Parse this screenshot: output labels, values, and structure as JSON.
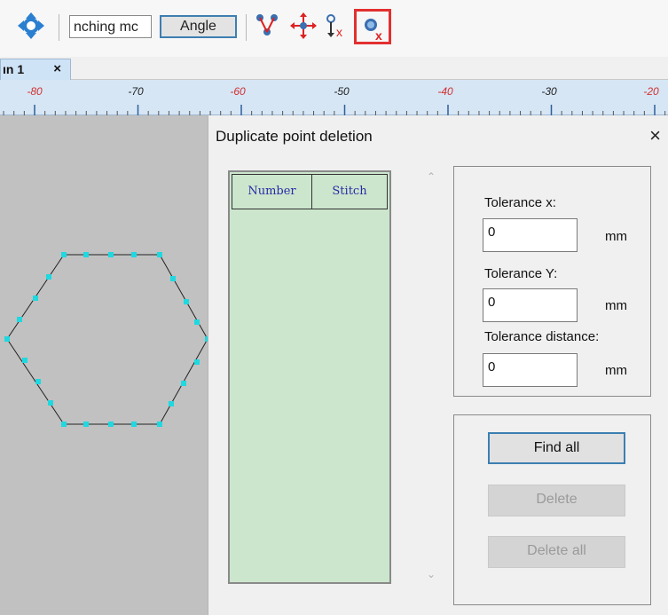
{
  "toolbar": {
    "stitching_mode_value": "nching mc",
    "angle_label": "Angle",
    "icons": [
      "arrows-move-icon",
      "merge-points-icon",
      "move-point-icon",
      "delete-point-icon",
      "duplicate-point-delete-icon"
    ],
    "active_tool_highlight": "#e23030"
  },
  "tab": {
    "label": "ın 1",
    "close": "×"
  },
  "ruler": {
    "labels": [
      "-80",
      "-70",
      "-60",
      "-50",
      "-40",
      "-30",
      "-20"
    ],
    "red_labels": [
      "-80",
      "-60",
      "-40",
      "-20"
    ]
  },
  "dialog": {
    "title": "Duplicate point deletion",
    "close": "×",
    "list": {
      "columns": [
        "Number",
        "Stitch"
      ],
      "rows": []
    },
    "tolerance_x_label": "Tolerance x:",
    "tolerance_x_value": "0",
    "tolerance_y_label": "Tolerance Y:",
    "tolerance_y_value": "0",
    "tolerance_distance_label": "Tolerance distance:",
    "tolerance_distance_value": "0",
    "unit": "mm",
    "find_all_label": "Find all",
    "delete_label": "Delete",
    "delete_all_label": "Delete all"
  },
  "colors": {
    "list_bg": "#cbe6cc",
    "point": "#1fd8e0",
    "canvas_bg": "#c1c1c1"
  }
}
